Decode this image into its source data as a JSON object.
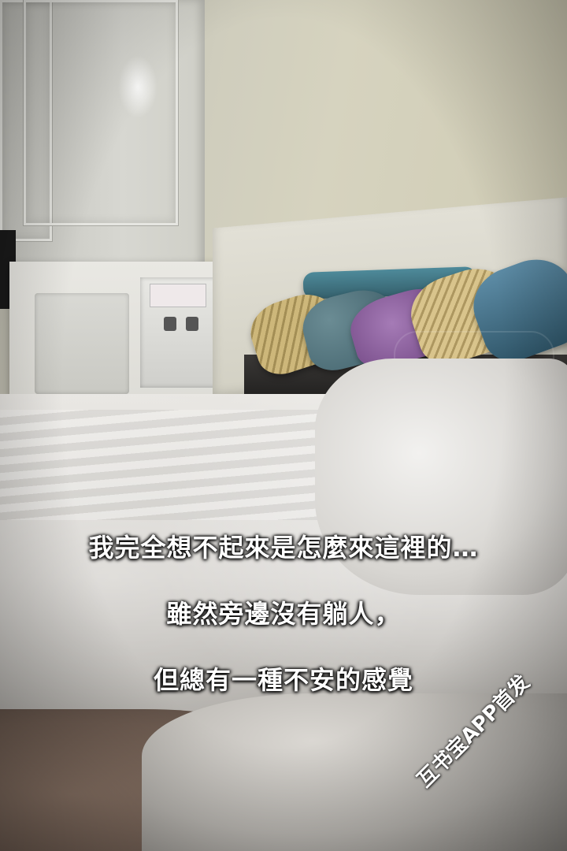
{
  "captions": {
    "line1": "我完全想不起來是怎麼來這裡的…",
    "line2": "雖然旁邊沒有躺人，",
    "line3": "但總有一種不安的感覺"
  },
  "badge": {
    "text": "互书宝APP首发"
  }
}
